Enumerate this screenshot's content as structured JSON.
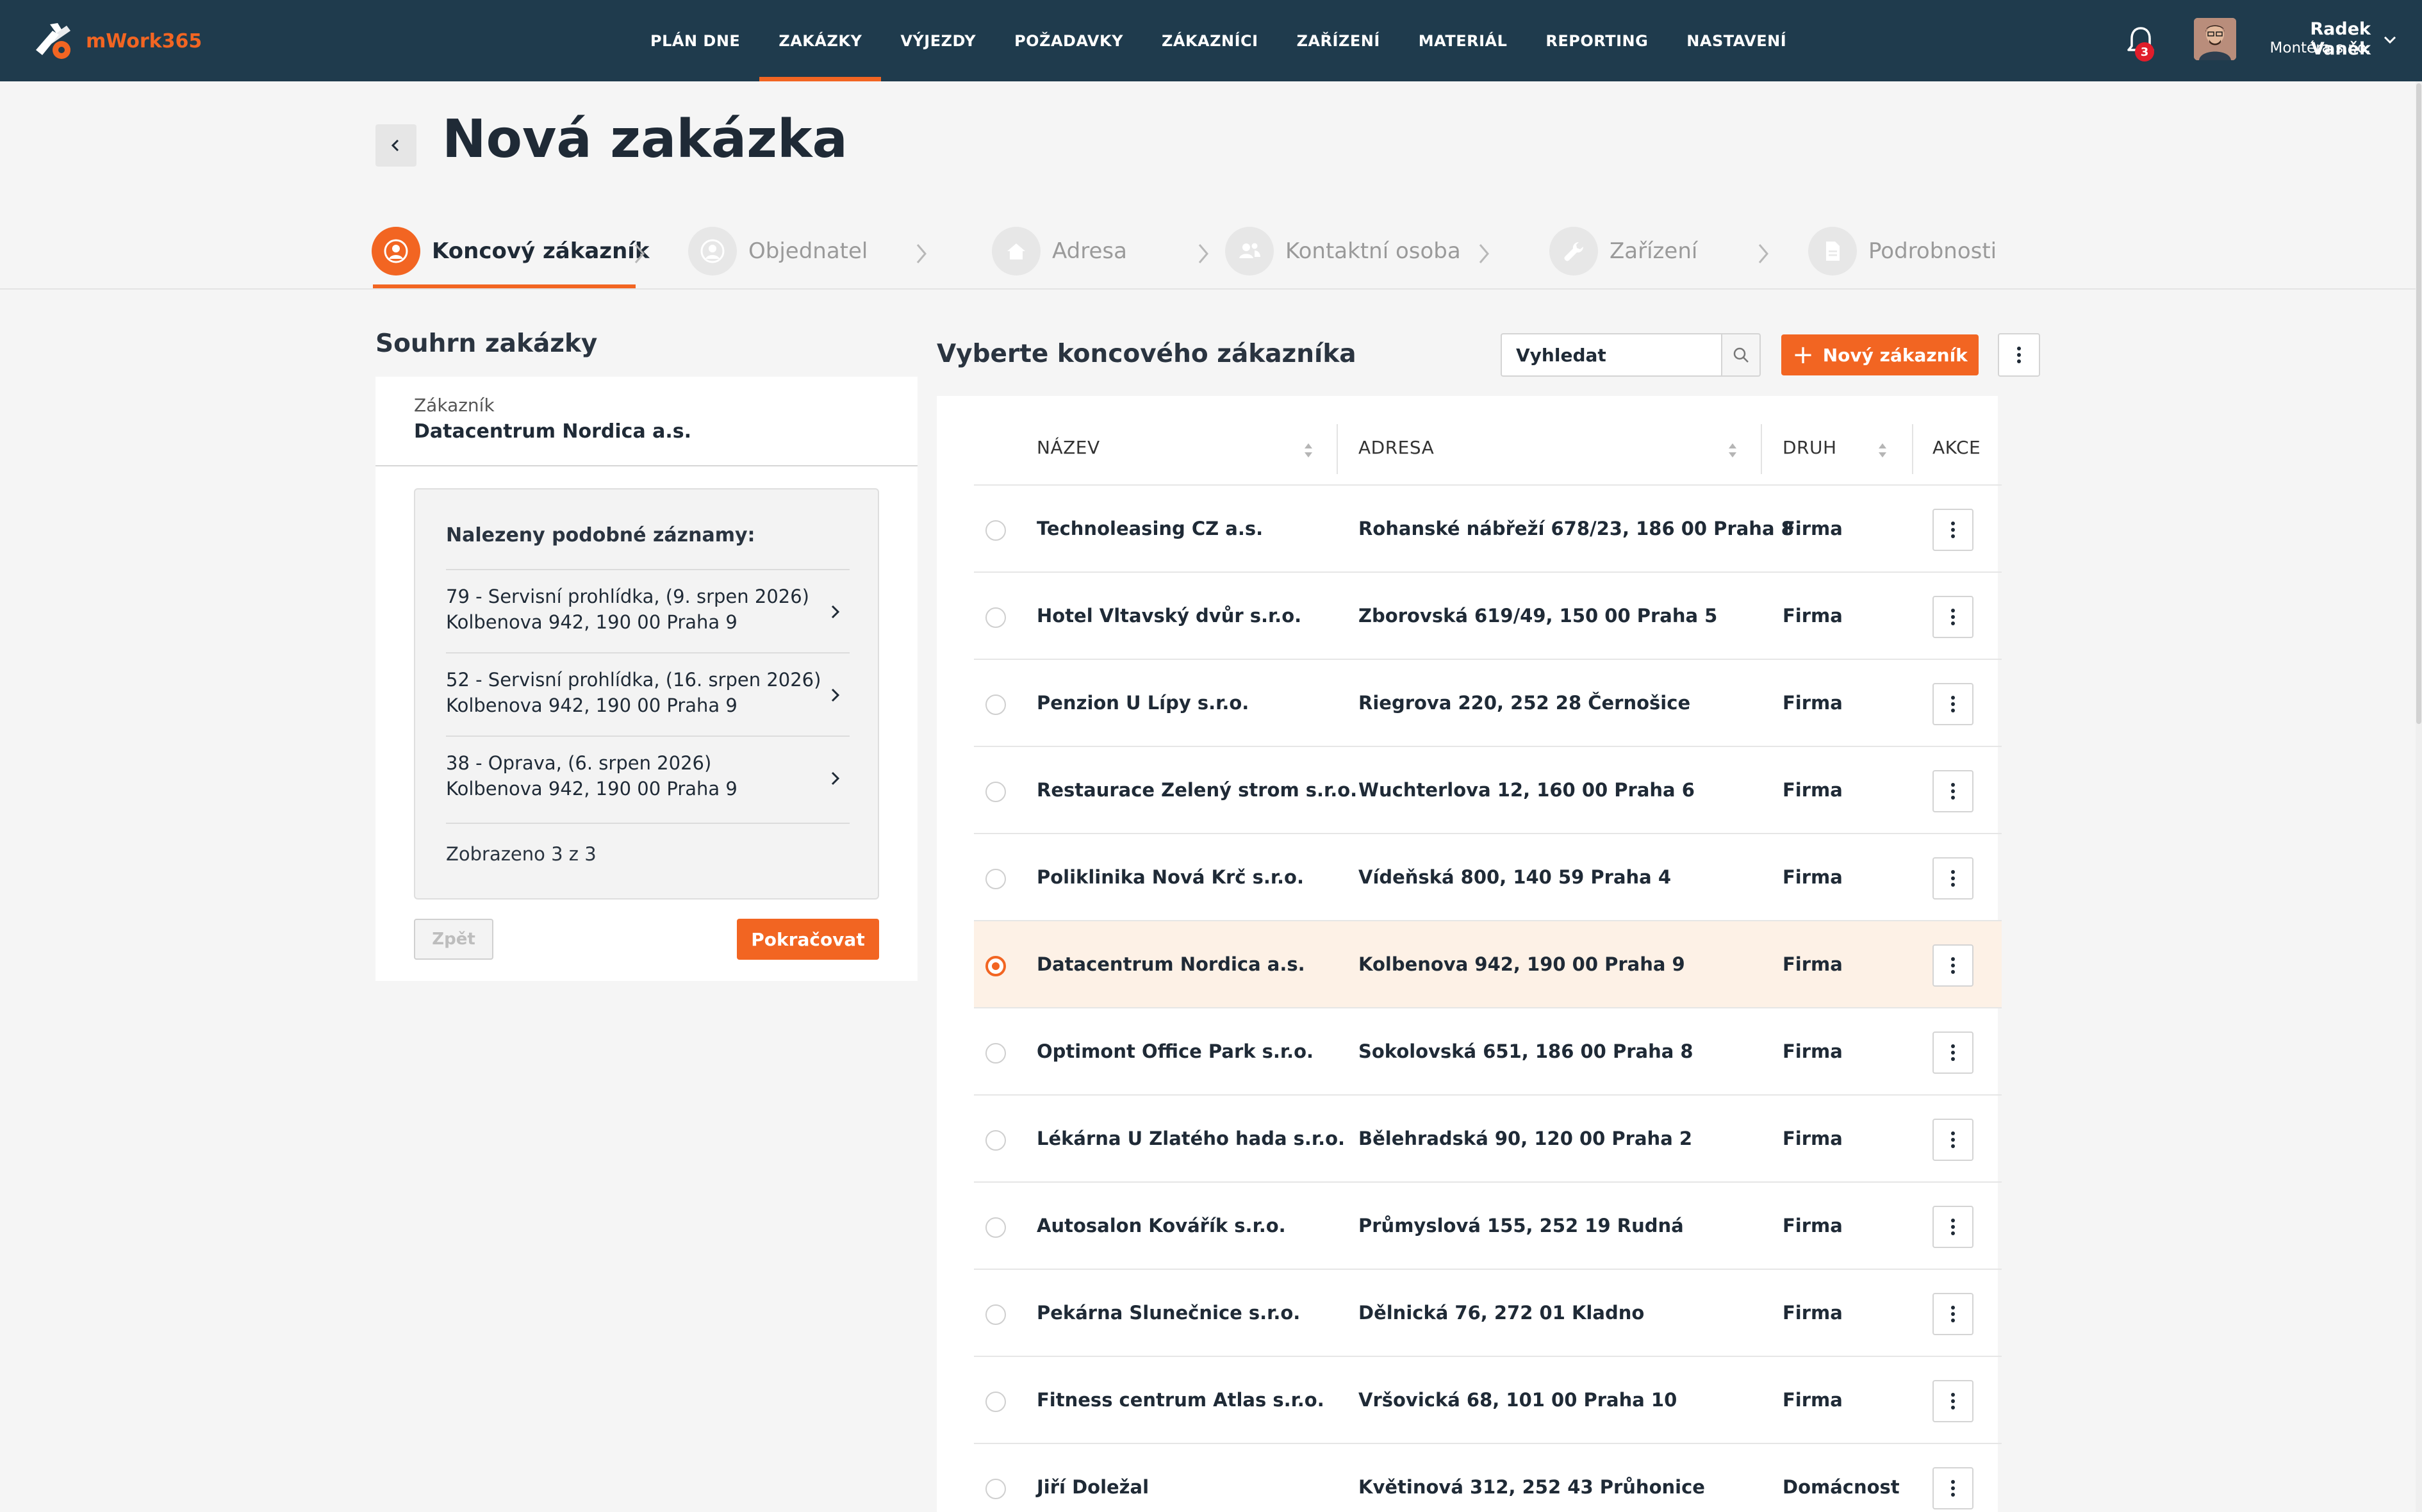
{
  "app": {
    "logo_text": "mWork365",
    "brand_color": "#f26522",
    "topbar_color": "#1f3b4d"
  },
  "nav": [
    {
      "label": "PLÁN DNE",
      "active": false
    },
    {
      "label": "ZAKÁZKY",
      "active": true
    },
    {
      "label": "VÝJEZDY",
      "active": false
    },
    {
      "label": "POŽADAVKY",
      "active": false
    },
    {
      "label": "ZÁKAZNÍCI",
      "active": false
    },
    {
      "label": "ZAŘÍZENÍ",
      "active": false
    },
    {
      "label": "MATERIÁL",
      "active": false
    },
    {
      "label": "REPORTING",
      "active": false
    },
    {
      "label": "NASTAVENÍ",
      "active": false
    }
  ],
  "notifications": {
    "count": "3",
    "icon": "bell-icon"
  },
  "user": {
    "name": "Radek Vaněk",
    "company": "Montéra s.r.o."
  },
  "page": {
    "title": "Nová zakázka"
  },
  "steps": [
    {
      "label": "Koncový zákazník",
      "icon": "user-circle-icon",
      "active": true
    },
    {
      "label": "Objednatel",
      "icon": "user-circle-icon",
      "active": false
    },
    {
      "label": "Adresa",
      "icon": "home-icon",
      "active": false
    },
    {
      "label": "Kontaktní osoba",
      "icon": "contacts-icon",
      "active": false
    },
    {
      "label": "Zařízení",
      "icon": "wrench-icon",
      "active": false
    },
    {
      "label": "Podrobnosti",
      "icon": "document-icon",
      "active": false
    }
  ],
  "summary": {
    "title": "Souhrn zakázky",
    "customer_label": "Zákazník",
    "customer_name": "Datacentrum Nordica a.s.",
    "similar_title": "Nalezeny podobné záznamy:",
    "similar": [
      {
        "line1": "79 - Servisní prohlídka, (9. srpen 2026)",
        "line2": "Kolbenova 942, 190 00 Praha 9"
      },
      {
        "line1": "52 - Servisní prohlídka, (16. srpen 2026)",
        "line2": "Kolbenova 942, 190 00 Praha 9"
      },
      {
        "line1": "38 - Oprava, (6. srpen 2026)",
        "line2": "Kolbenova 942, 190 00 Praha 9"
      }
    ],
    "count_text": "Zobrazeno 3 z 3",
    "back_label": "Zpět",
    "continue_label": "Pokračovat"
  },
  "customers": {
    "title": "Vyberte koncového zákazníka",
    "search_placeholder": "Vyhledat",
    "new_label": "Nový zákazník",
    "columns": {
      "name": "NÁZEV",
      "address": "ADRESA",
      "kind": "DRUH",
      "actions": "AKCE"
    },
    "rows": [
      {
        "name": "Technoleasing CZ a.s.",
        "address": "Rohanské nábřeží 678/23, 186 00 Praha 8",
        "kind": "Firma",
        "selected": false
      },
      {
        "name": "Hotel Vltavský dvůr s.r.o.",
        "address": "Zborovská 619/49, 150 00 Praha 5",
        "kind": "Firma",
        "selected": false
      },
      {
        "name": "Penzion U Lípy s.r.o.",
        "address": "Riegrova 220, 252 28 Černošice",
        "kind": "Firma",
        "selected": false
      },
      {
        "name": "Restaurace Zelený strom s.r.o.",
        "address": "Wuchterlova 12, 160 00 Praha 6",
        "kind": "Firma",
        "selected": false
      },
      {
        "name": "Poliklinika Nová Krč s.r.o.",
        "address": "Vídeňská 800, 140 59 Praha 4",
        "kind": "Firma",
        "selected": false
      },
      {
        "name": "Datacentrum Nordica a.s.",
        "address": "Kolbenova 942, 190 00 Praha 9",
        "kind": "Firma",
        "selected": true
      },
      {
        "name": "Optimont Office Park s.r.o.",
        "address": "Sokolovská 651, 186 00 Praha 8",
        "kind": "Firma",
        "selected": false
      },
      {
        "name": "Lékárna U Zlatého hada s.r.o.",
        "address": "Bělehradská 90, 120 00 Praha 2",
        "kind": "Firma",
        "selected": false
      },
      {
        "name": "Autosalon Kovářík s.r.o.",
        "address": "Průmyslová 155, 252 19 Rudná",
        "kind": "Firma",
        "selected": false
      },
      {
        "name": "Pekárna Slunečnice s.r.o.",
        "address": "Dělnická 76, 272 01 Kladno",
        "kind": "Firma",
        "selected": false
      },
      {
        "name": "Fitness centrum Atlas s.r.o.",
        "address": "Vršovická 68, 101 00 Praha 10",
        "kind": "Firma",
        "selected": false
      },
      {
        "name": "Jiří Doležal",
        "address": "Květinová 312, 252 43 Průhonice",
        "kind": "Domácnost",
        "selected": false
      }
    ]
  }
}
